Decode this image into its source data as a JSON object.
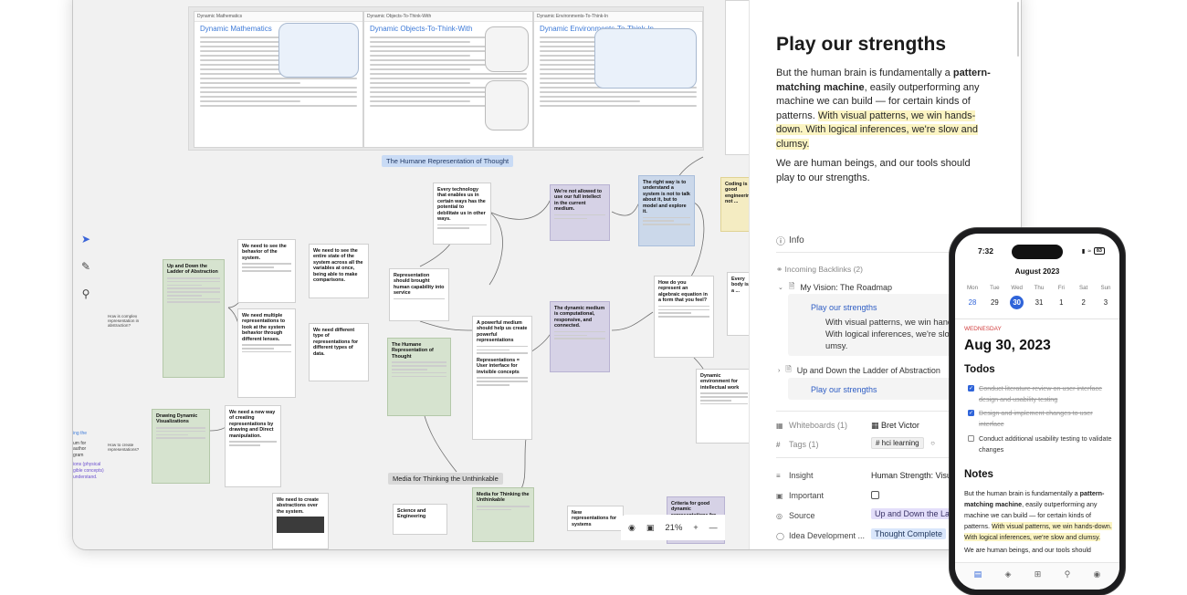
{
  "canvas": {
    "top_docs": [
      {
        "header": "Dynamic Mathematics",
        "title": "Dynamic Mathematics"
      },
      {
        "header": "Dynamic Objects-To-Think-With",
        "title": "Dynamic Objects-To-Think-With"
      },
      {
        "header": "Dynamic Environments-To-Think-In",
        "title": "Dynamic Environments-To-Think-In"
      }
    ],
    "group_labels": {
      "humane": "The Humane Representation of Thought",
      "media": "Media for Thinking the Unthinkable"
    },
    "cards": {
      "every_tech": "Every technology that enables us in certain ways has the potential to debilitate us in other ways.",
      "not_allowed": "We're not allowed to use our full intellect in the current medium.",
      "right_way": "The right way is to understand a system is not to talk about it, but to model and explore it.",
      "coding": "Coding is good engineering, not ...",
      "ladder": "Up and Down the Ladder of Abstraction",
      "behavior": "We need to see the behavior of the system.",
      "entire_state": "We need to see the entire state of the system across all the variables at once, being able to make comparisons.",
      "rep_brought": "Representation should brought human capability into service",
      "multiple": "We need multiple representations to look at the system behavior through different lenses.",
      "different_type": "We need different type of representations for different types of data.",
      "humane_rep": "The Humane Representation of Thought",
      "powerful_medium": "A powerful medium should help us create powerful representations",
      "dynamic_medium": "The dynamic medium is computational, responsive, and connected.",
      "algebraic": "How do you represent an algebraic equation in a form that you feel?",
      "body": "Every body is a ...",
      "drawing_dynamic": "Drawing Dynamic Visualizations",
      "new_way": "We need a new way of creating representations by drawing and Direct manipulation.",
      "reps_ui": "Representations = User interface for invisible concepts",
      "dyn_env": "Dynamic environment for intellectual work",
      "create_abstractions": "We need to create abstractions over the system.",
      "science": "Science and Engineering",
      "media_card": "Media for Thinking the Unthinkable",
      "new_reps": "New representations for systems",
      "criteria": "Criteria for good dynamic representations for exploring systems",
      "we_need_to": "We need to ..."
    },
    "left_edge_text": [
      "ing the",
      "um for",
      "author",
      "gram",
      "ions (physical",
      "gible concepts)",
      "understand."
    ],
    "side_notes": [
      "How is complex representation in abstraction?",
      "How to create representations?"
    ],
    "zoom": "21%"
  },
  "sidebar": {
    "title": "Play our strengths",
    "para1_a": "But the human brain is fundamentally a ",
    "para1_b": "pattern-matching machine",
    "para1_c": ", easily outperforming any machine we can build — for certain kinds of patterns. ",
    "para1_hl": "With visual patterns, we win hands-down. With logical inferences, we're slow and clumsy.",
    "para2": "We are human beings, and our tools should play to our strengths.",
    "info": "Info",
    "backlinks_header": "Incoming Backlinks (2)",
    "backlinks": [
      {
        "title": "My Vision: The Roadmap",
        "link": "Play our strengths",
        "quote1": "With visual patterns, we win hands",
        "quote2": "With logical inferences, we're slow",
        "quote3": "umsy."
      },
      {
        "title": "Up and Down the Ladder of Abstraction",
        "link": "Play our strengths"
      }
    ],
    "properties": [
      {
        "key": "Whiteboards (1)",
        "value": "Bret Victor"
      },
      {
        "key": "Tags (1)",
        "value": "# hci learning"
      },
      {
        "key": "Insight",
        "value": "Human Strength: Visua"
      },
      {
        "key": "Important",
        "value": ""
      },
      {
        "key": "Source",
        "value": "Up and Down the Lad"
      },
      {
        "key": "Idea Development ...",
        "value": "Thought Complete"
      }
    ]
  },
  "phone": {
    "time": "7:32",
    "battery": "83",
    "month": "August 2023",
    "week": [
      {
        "dn": "Mon",
        "dd": "28"
      },
      {
        "dn": "Tue",
        "dd": "29"
      },
      {
        "dn": "Wed",
        "dd": "30"
      },
      {
        "dn": "Thu",
        "dd": "31"
      },
      {
        "dn": "Fri",
        "dd": "1"
      },
      {
        "dn": "Sat",
        "dd": "2"
      },
      {
        "dn": "Sun",
        "dd": "3"
      }
    ],
    "weekday": "WEDNESDAY",
    "date": "Aug 30, 2023",
    "todos_title": "Todos",
    "todos": [
      {
        "text": "Conduct literature review on user interface design and usability testing",
        "done": true
      },
      {
        "text": "Design and implement changes to user interface",
        "done": true
      },
      {
        "text": "Conduct additional usability testing to validate changes",
        "done": false
      }
    ],
    "notes_title": "Notes",
    "notes_a": "But the human brain is fundamentally a ",
    "notes_b": "pattern-matching machine",
    "notes_c": ", easily outperforming any machine we can build — for certain kinds of patterns. ",
    "notes_hl": "With visual patterns, we win hands-down. With logical inferences, we're slow and clumsy.",
    "notes_d": "We are human beings, and our tools should"
  },
  "colors": {
    "accent": "#2f64d9",
    "highlight": "#fbf4c2",
    "card_green": "#d6e3cf",
    "card_purple": "#d6d2e6",
    "card_blue": "#cbd8ea",
    "group_label_blue": "#c9dbf5"
  },
  "icons": [
    "pointer-icon",
    "pen-icon",
    "search-icon",
    "info-icon",
    "page-icon",
    "whiteboard-icon",
    "tag-icon",
    "text-icon",
    "checkbox-icon",
    "source-icon",
    "status-icon",
    "eye-icon",
    "layout-icon",
    "plus-icon",
    "minus-icon",
    "calendar-icon",
    "layers-icon",
    "add-icon",
    "profile-icon"
  ]
}
